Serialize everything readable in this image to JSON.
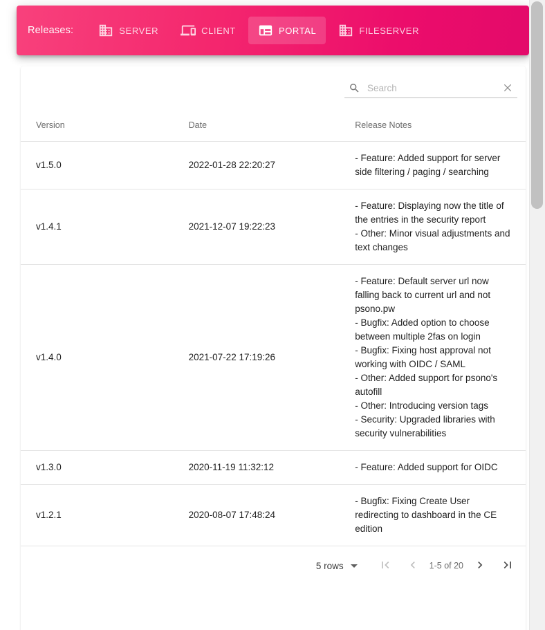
{
  "header": {
    "label": "Releases:",
    "tabs": [
      {
        "label": "SERVER",
        "icon": "domain-icon",
        "active": false
      },
      {
        "label": "CLIENT",
        "icon": "devices-icon",
        "active": false
      },
      {
        "label": "PORTAL",
        "icon": "web-icon",
        "active": true
      },
      {
        "label": "FILESERVER",
        "icon": "domain-icon",
        "active": false
      }
    ],
    "gradient_from": "#f8417c",
    "gradient_to": "#e30a6a"
  },
  "search": {
    "value": "",
    "placeholder": "Search",
    "search_icon": "search-icon",
    "clear_icon": "close-icon"
  },
  "table": {
    "columns": [
      "Version",
      "Date",
      "Release Notes"
    ],
    "rows": [
      {
        "version": "v1.5.0",
        "date": "2022-01-28 22:20:27",
        "notes": "- Feature: Added support for server side filtering / paging / searching"
      },
      {
        "version": "v1.4.1",
        "date": "2021-12-07 19:22:23",
        "notes": "- Feature: Displaying now the title of the entries in the security report\n- Other: Minor visual adjustments and text changes"
      },
      {
        "version": "v1.4.0",
        "date": "2021-07-22 17:19:26",
        "notes": "- Feature: Default server url now falling back to current url and not psono.pw\n- Bugfix: Added option to choose between multiple 2fas on login\n- Bugfix: Fixing host approval not working with OIDC / SAML\n- Other: Added support for psono's autofill\n- Other: Introducing version tags\n- Security: Upgraded libraries with security vulnerabilities"
      },
      {
        "version": "v1.3.0",
        "date": "2020-11-19 11:32:12",
        "notes": "- Feature: Added support for OIDC"
      },
      {
        "version": "v1.2.1",
        "date": "2020-08-07 17:48:24",
        "notes": "- Bugfix: Fixing Create User redirecting to dashboard in the CE edition"
      }
    ]
  },
  "pagination": {
    "rows_per_page_label": "5 rows",
    "range_label": "1-5 of 20",
    "first_page_icon": "first-page-icon",
    "previous_page_icon": "chevron-left-icon",
    "next_page_icon": "chevron-right-icon",
    "last_page_icon": "last-page-icon",
    "dropdown_icon": "chevron-down-icon"
  }
}
